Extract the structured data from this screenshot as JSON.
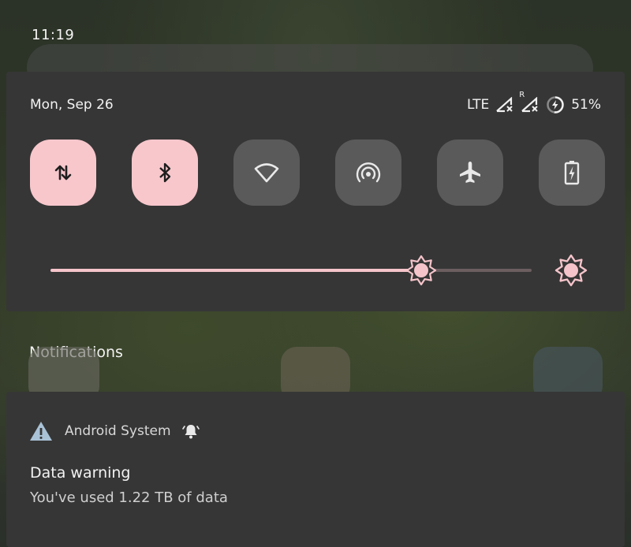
{
  "status_bar": {
    "time": "11:19"
  },
  "quick_settings": {
    "date": "Mon, Sep 26",
    "network_type": "LTE",
    "roaming_indicator": "R",
    "battery_percent": "51%",
    "tiles": [
      {
        "name": "mobile-data",
        "icon": "mobile-data-icon",
        "active": true
      },
      {
        "name": "bluetooth",
        "icon": "bluetooth-icon",
        "active": true
      },
      {
        "name": "wifi",
        "icon": "wifi-icon",
        "active": false
      },
      {
        "name": "hotspot",
        "icon": "hotspot-icon",
        "active": false
      },
      {
        "name": "airplane-mode",
        "icon": "airplane-icon",
        "active": false
      },
      {
        "name": "battery-saver",
        "icon": "battery-saver-icon",
        "active": false
      }
    ],
    "brightness_level": 0.77,
    "accent_color": "#f7c7cc"
  },
  "notifications": {
    "header": "Notifications",
    "items": [
      {
        "app": "Android System",
        "title": "Data warning",
        "text": "You've used 1.22 TB of data"
      }
    ]
  }
}
